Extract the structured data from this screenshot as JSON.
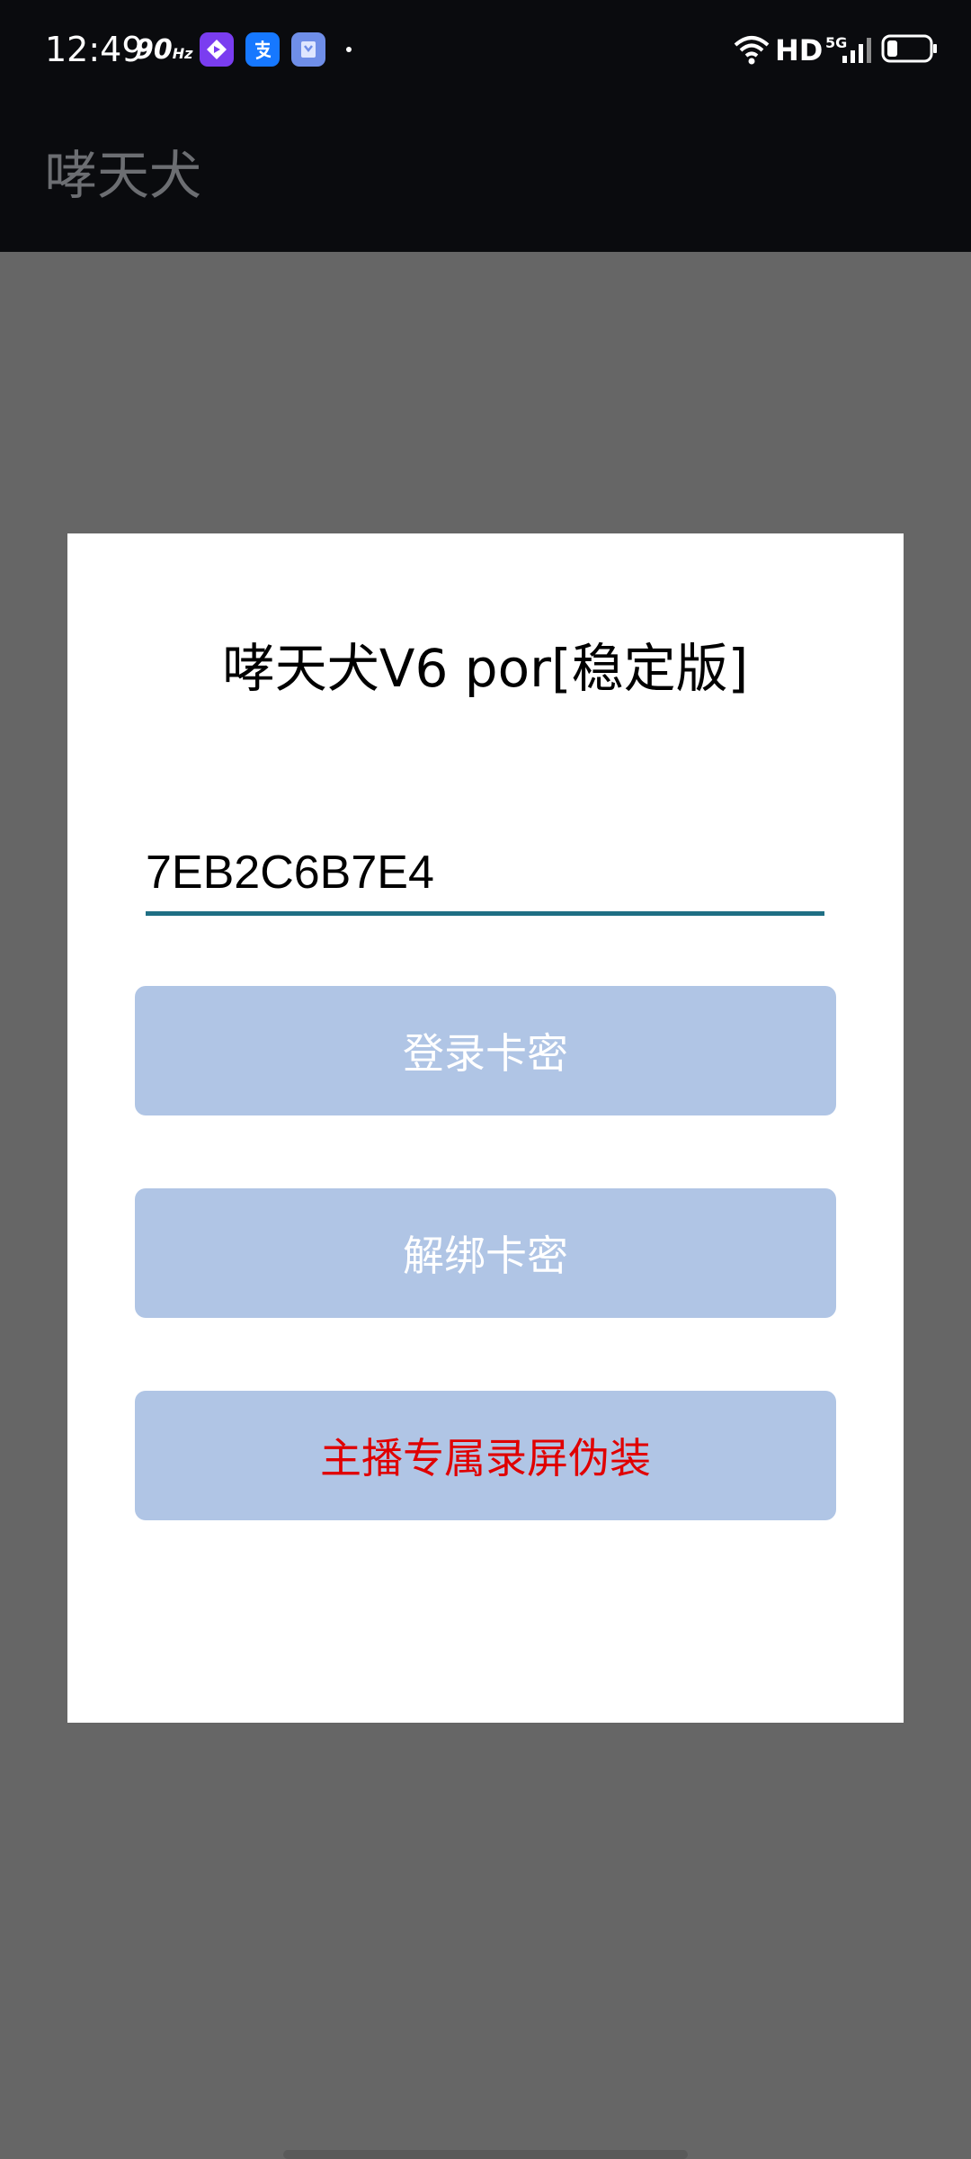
{
  "status_bar": {
    "time": "12:49",
    "refresh_rate": "90",
    "refresh_unit": "Hz",
    "network": "HD",
    "network_gen": "5G",
    "app_icons": [
      "video-app-icon",
      "alipay-icon",
      "store-app-icon"
    ],
    "battery_level": 0.25
  },
  "app_bar": {
    "title": "哮天犬"
  },
  "dialog": {
    "title": "哮天犬V6 por[稳定版]",
    "card_input": {
      "value": "7EB2C6B7E4"
    },
    "buttons": {
      "login": "登录卡密",
      "unbind": "解绑卡密",
      "disguise": "主播专属录屏伪装"
    }
  },
  "colors": {
    "status_bg": "#0a0b0e",
    "overlay": "#666666",
    "button_bg": "#b0c5e5",
    "input_underline": "#1f6f84",
    "danger_text": "#e00000"
  }
}
